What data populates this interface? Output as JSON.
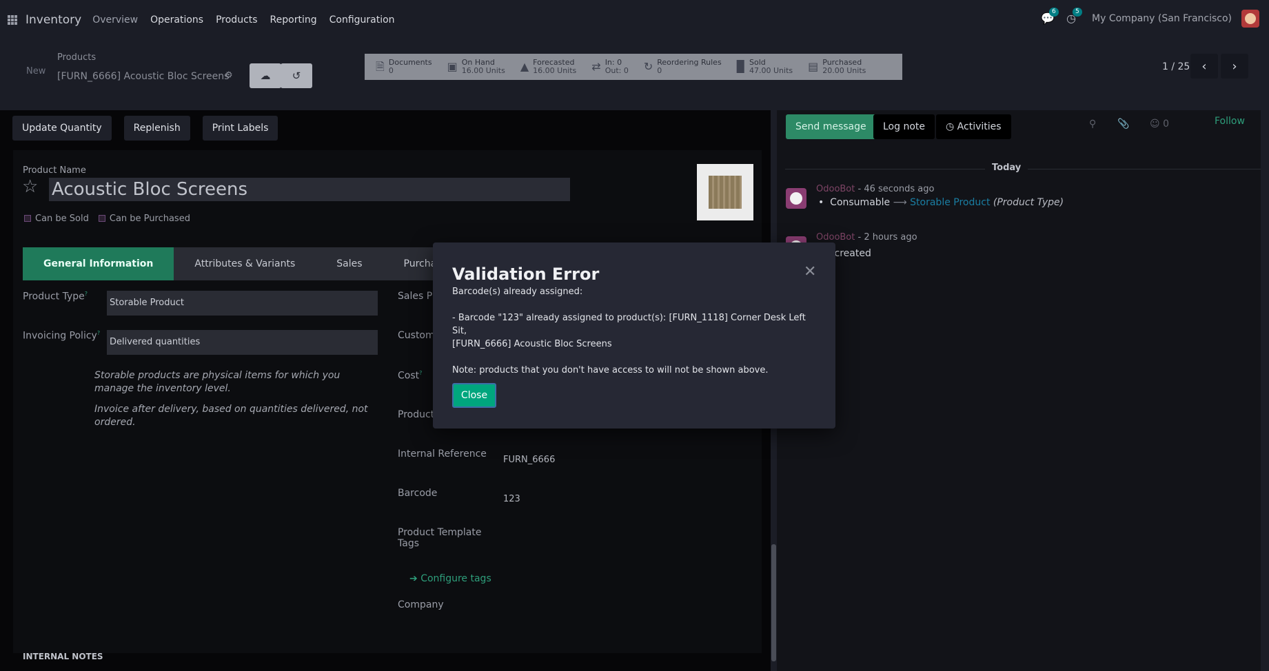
{
  "navbar": {
    "app_name": "Inventory",
    "menu": [
      "Overview",
      "Operations",
      "Products",
      "Reporting",
      "Configuration"
    ],
    "messages_badge": "6",
    "activities_badge": "5",
    "company": "My Company (San Francisco)"
  },
  "control": {
    "new_label": "New",
    "breadcrumb_parent": "Products",
    "breadcrumb_current": "[FURN_6666] Acoustic Bloc Screens",
    "pager": "1 / 25"
  },
  "smart_buttons": [
    {
      "label": "Documents",
      "value": "0",
      "icon": "file-icon"
    },
    {
      "label": "On Hand",
      "value": "16.00 Units",
      "icon": "cubes-icon"
    },
    {
      "label": "Forecasted",
      "value": "16.00 Units",
      "icon": "area-chart-icon"
    },
    {
      "label": "In: 0",
      "value": "Out: 0",
      "icon": "exchange-icon"
    },
    {
      "label": "Reordering Rules",
      "value": "0",
      "icon": "refresh-icon"
    },
    {
      "label": "Sold",
      "value": "47.00 Units",
      "icon": "signal-icon"
    },
    {
      "label": "Purchased",
      "value": "20.00 Units",
      "icon": "credit-card-icon"
    }
  ],
  "statusbar": {
    "update_quantity": "Update Quantity",
    "replenish": "Replenish",
    "print_labels": "Print Labels"
  },
  "form": {
    "product_name_label": "Product Name",
    "product_name": "Acoustic Bloc Screens",
    "can_be_sold": "Can be Sold",
    "can_be_purchased": "Can be Purchased",
    "tabs": [
      "General Information",
      "Attributes & Variants",
      "Sales",
      "Purchase"
    ],
    "product_type_label": "Product Type",
    "product_type": "Storable Product",
    "invoicing_policy_label": "Invoicing Policy",
    "invoicing_policy": "Delivered quantities",
    "help_storable": "Storable products are physical items for which you manage the inventory level.",
    "help_invoice": "Invoice after delivery, based on quantities delivered, not ordered.",
    "sales_price_label": "Sales Pr",
    "customer_taxes_label": "Custom",
    "cost_label": "Cost",
    "product_category_label": "Product",
    "internal_reference_label": "Internal Reference",
    "internal_reference": "FURN_6666",
    "barcode_label": "Barcode",
    "barcode": "123",
    "template_tags_label_1": "Product Template",
    "template_tags_label_2": "Tags",
    "configure_tags": "Configure tags",
    "company_label": "Company",
    "internal_notes": "INTERNAL NOTES"
  },
  "chatter": {
    "send_message": "Send message",
    "log_note": "Log note",
    "activities": "Activities",
    "followers_count": "0",
    "follow": "Follow",
    "today": "Today",
    "messages": [
      {
        "author": "OdooBot",
        "time": "- 46 seconds ago",
        "old_value": "Consumable",
        "new_value": "Storable Product",
        "field": "(Product Type)"
      },
      {
        "author": "OdooBot",
        "time": "- 2 hours ago",
        "body": "uct created"
      }
    ]
  },
  "dialog": {
    "title": "Validation Error",
    "line1": "Barcode(s) already assigned:",
    "line2": "- Barcode \"123\" already assigned to product(s): [FURN_1118] Corner Desk Left Sit,",
    "line3": "[FURN_6666] Acoustic Bloc Screens",
    "line4": "Note: products that you don't have access to will not be shown above.",
    "close_button": "Close"
  }
}
